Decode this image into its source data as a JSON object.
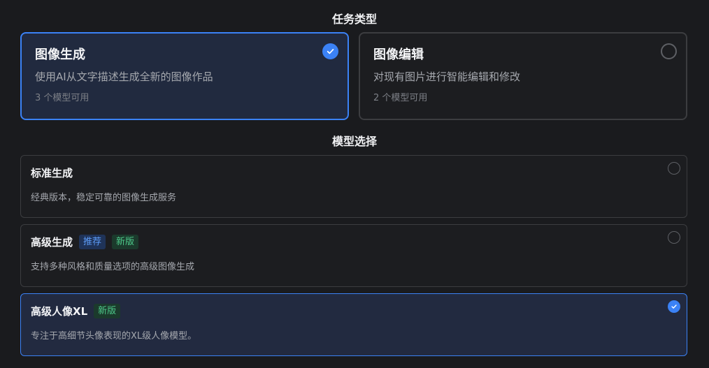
{
  "task_section": {
    "title": "任务类型",
    "options": [
      {
        "name": "图像生成",
        "description": "使用AI从文字描述生成全新的图像作品",
        "model_count": "3 个模型可用",
        "selected": true
      },
      {
        "name": "图像编辑",
        "description": "对现有图片进行智能编辑和修改",
        "model_count": "2 个模型可用",
        "selected": false
      }
    ]
  },
  "model_section": {
    "title": "模型选择",
    "options": [
      {
        "name": "标准生成",
        "description": "经典版本，稳定可靠的图像生成服务",
        "badges": [],
        "selected": false
      },
      {
        "name": "高级生成",
        "description": "支持多种风格和质量选项的高级图像生成",
        "badges": [
          "推荐",
          "新版"
        ],
        "selected": false
      },
      {
        "name": "高级人像XL",
        "description": "专注于高细节头像表现的XL级人像模型。",
        "badges": [
          "新版"
        ],
        "selected": true
      }
    ]
  },
  "colors": {
    "accent": "#3b82f6",
    "background": "#1a1b1e",
    "badge_recommend": "#5c9bf5",
    "badge_new": "#4ec98a"
  },
  "icons": {
    "selected": "check-icon",
    "unselected": "radio-empty-icon"
  }
}
